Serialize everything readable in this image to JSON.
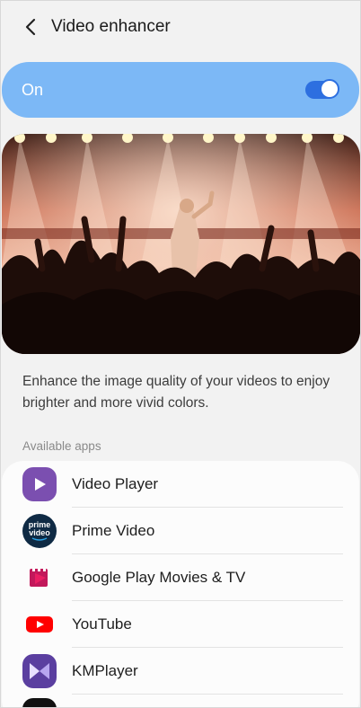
{
  "header": {
    "title": "Video enhancer"
  },
  "toggle": {
    "label": "On",
    "enabled": true,
    "accent": "#7cb8f6"
  },
  "hero": {
    "subject": "concert crowd"
  },
  "description": "Enhance the image quality of your videos to enjoy brighter and more vivid colors.",
  "available_apps_label": "Available apps",
  "apps": [
    {
      "name": "Video Player",
      "icon": "video-player-icon"
    },
    {
      "name": "Prime Video",
      "icon": "prime-video-icon",
      "icon_text_1": "prime",
      "icon_text_2": "video"
    },
    {
      "name": "Google Play Movies & TV",
      "icon": "play-movies-icon"
    },
    {
      "name": "YouTube",
      "icon": "youtube-icon"
    },
    {
      "name": "KMPlayer",
      "icon": "kmplayer-icon"
    }
  ]
}
